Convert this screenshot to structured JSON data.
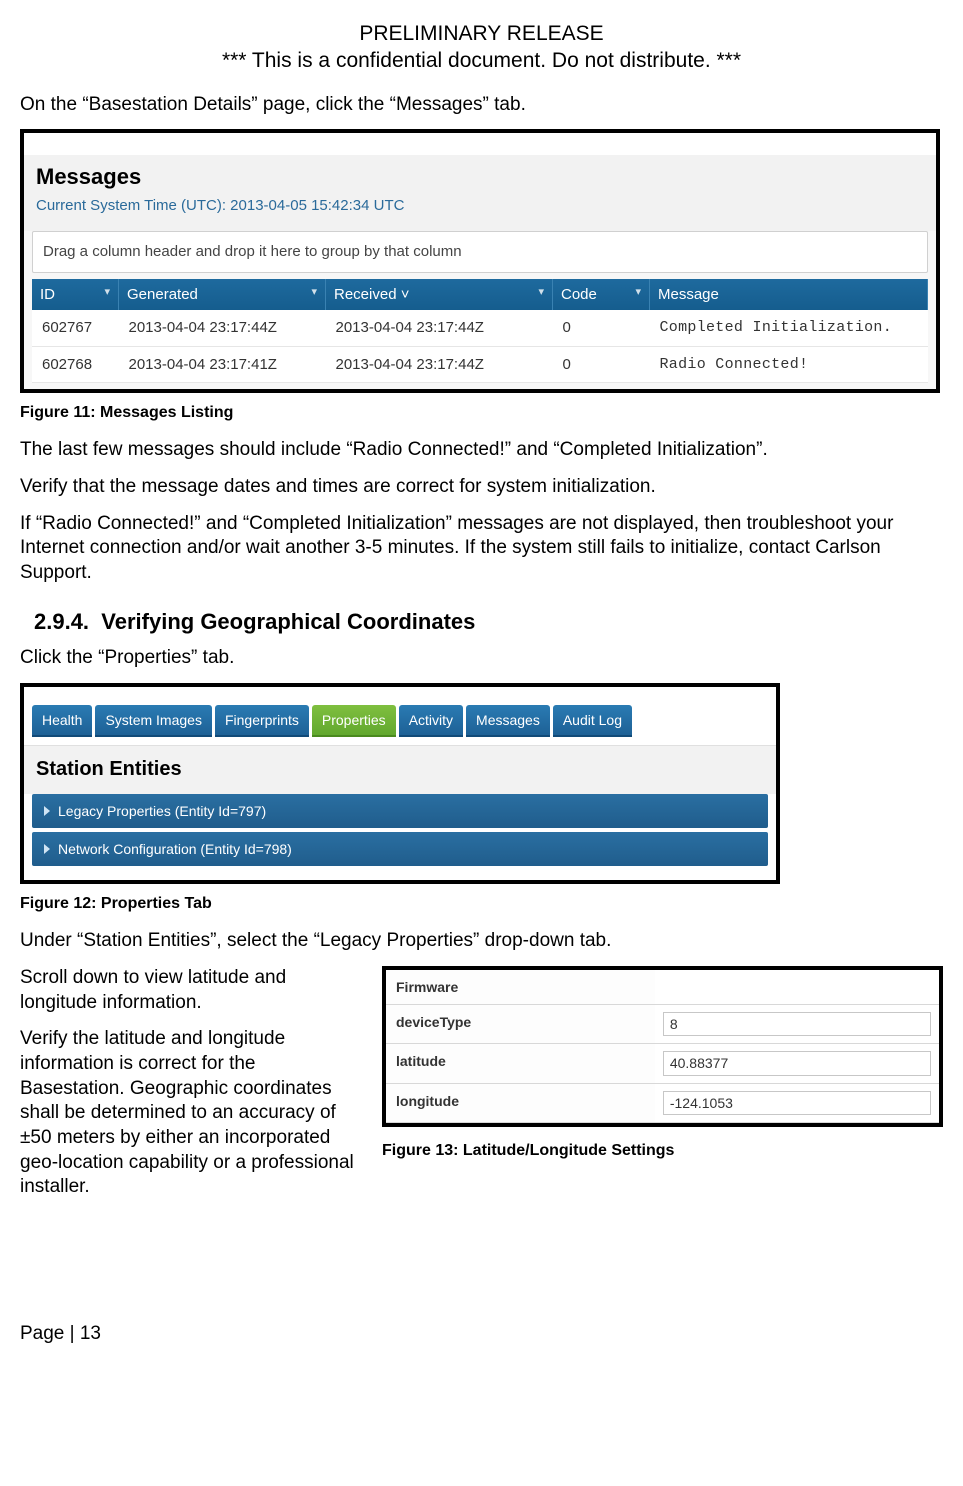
{
  "header": {
    "line1": "PRELIMINARY RELEASE",
    "line2": "*** This is a confidential document. Do not distribute. ***"
  },
  "intro": "On the “Basestation Details” page, click the “Messages” tab.",
  "fig11": {
    "title": "Messages",
    "systime_label": "Current System Time (UTC): 2013-04-05 15:42:34 UTC",
    "drag_hint": "Drag a column header and drop it here to group by that column",
    "cols": {
      "id": "ID",
      "gen": "Generated",
      "recv": "Received",
      "recv_sort": "˅",
      "code": "Code",
      "msg": "Message"
    },
    "rows": [
      {
        "id": "602767",
        "gen": "2013-04-04 23:17:44Z",
        "recv": "2013-04-04 23:17:44Z",
        "code": "0",
        "msg": "Completed Initialization."
      },
      {
        "id": "602768",
        "gen": "2013-04-04 23:17:41Z",
        "recv": "2013-04-04 23:17:44Z",
        "code": "0",
        "msg": "Radio Connected!"
      }
    ],
    "caption": "Figure 11: Messages Listing"
  },
  "body1": "The last few messages should include “Radio Connected!” and “Completed Initialization”.",
  "body2": "Verify that the message dates and times are correct for system initialization.",
  "body3": "If “Radio Connected!” and “Completed Initialization” messages are not displayed, then troubleshoot your Internet connection and/or wait another 3-5 minutes. If the system still fails to initialize, contact Carlson Support.",
  "section": {
    "num": "2.9.4.",
    "title": "Verifying Geographical Coordinates"
  },
  "body4": "Click the “Properties” tab.",
  "fig12": {
    "tabs": [
      "Health",
      "System Images",
      "Fingerprints",
      "Properties",
      "Activity",
      "Messages",
      "Audit Log"
    ],
    "active_index": 3,
    "panel_title": "Station Entities",
    "rows": [
      "Legacy Properties (Entity Id=797)",
      "Network Configuration (Entity Id=798)"
    ],
    "caption": "Figure 12: Properties Tab"
  },
  "body5": "Under “Station Entities”, select the “Legacy Properties” drop-down tab.",
  "body6": "Scroll down to view latitude and longitude information.",
  "body7": "Verify the latitude and longitude information is correct for the Basestation. Geographic coordinates shall be determined to an accuracy of ±50 meters by either an incorporated geo-location capability or a professional installer.",
  "fig13": {
    "rows": [
      {
        "k": "Firmware",
        "v": ""
      },
      {
        "k": "deviceType",
        "v": "8"
      },
      {
        "k": "latitude",
        "v": "40.88377"
      },
      {
        "k": "longitude",
        "v": "-124.1053"
      }
    ],
    "caption": "Figure 13: Latitude/Longitude Settings"
  },
  "footer": "Page | 13"
}
